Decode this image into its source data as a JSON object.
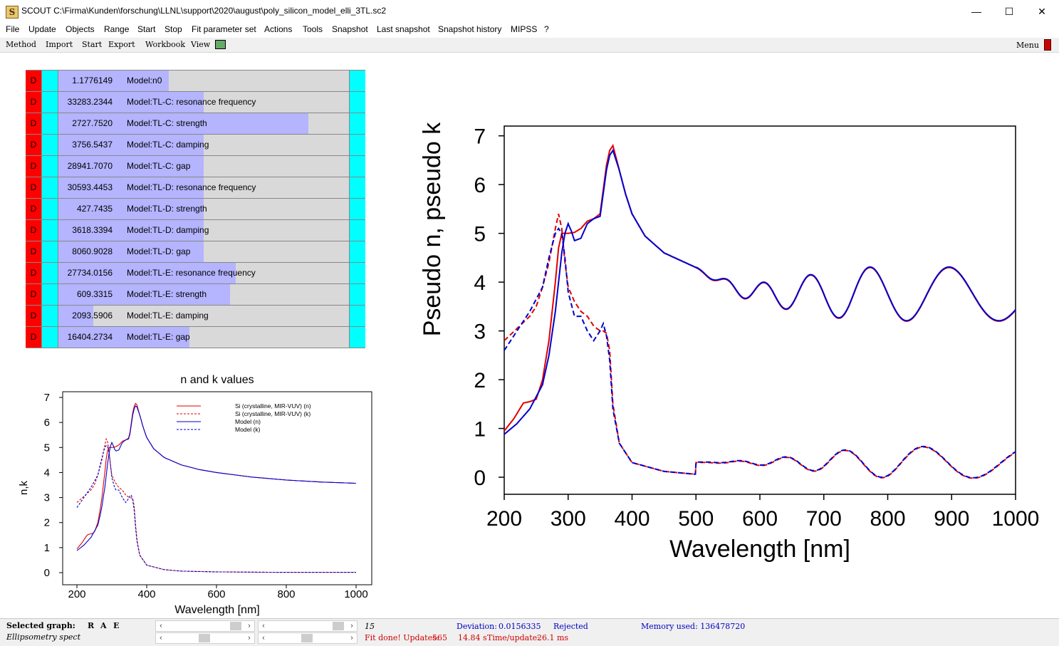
{
  "window": {
    "title": "SCOUT C:\\Firma\\Kunden\\forschung\\LLNL\\support\\2020\\august\\poly_silicon_model_elli_3TL.sc2",
    "icon": "S",
    "minimize": "—",
    "maximize": "☐",
    "close": "✕"
  },
  "menu": [
    "File",
    "Update",
    "Objects",
    "Range",
    "Start",
    "Stop",
    "Fit parameter set",
    "Actions",
    "Tools",
    "Snapshot",
    "Last snapshot",
    "Snapshot history",
    "MIPSS",
    "?"
  ],
  "toolbar": {
    "items": [
      "Method",
      "Import",
      "Start",
      "Export",
      "Workbook",
      "View"
    ],
    "menu_label": "Menu"
  },
  "params": [
    {
      "flag": "D",
      "value": "1.1776149",
      "label": "Model:n0",
      "fill": 0.38
    },
    {
      "flag": "D",
      "value": "33283.2344",
      "label": "Model:TL-C: resonance frequency",
      "fill": 0.5
    },
    {
      "flag": "D",
      "value": "2727.7520",
      "label": "Model:TL-C: strength",
      "fill": 0.86
    },
    {
      "flag": "D",
      "value": "3756.5437",
      "label": "Model:TL-C: damping",
      "fill": 0.5
    },
    {
      "flag": "D",
      "value": "28941.7070",
      "label": "Model:TL-C: gap",
      "fill": 0.5
    },
    {
      "flag": "D",
      "value": "30593.4453",
      "label": "Model:TL-D: resonance frequency",
      "fill": 0.5
    },
    {
      "flag": "D",
      "value": "427.7435",
      "label": "Model:TL-D: strength",
      "fill": 0.5
    },
    {
      "flag": "D",
      "value": "3618.3394",
      "label": "Model:TL-D: damping",
      "fill": 0.5
    },
    {
      "flag": "D",
      "value": "8060.9028",
      "label": "Model:TL-D: gap",
      "fill": 0.5
    },
    {
      "flag": "D",
      "value": "27734.0156",
      "label": "Model:TL-E: resonance frequency",
      "fill": 0.61
    },
    {
      "flag": "D",
      "value": "609.3315",
      "label": "Model:TL-E: strength",
      "fill": 0.59
    },
    {
      "flag": "D",
      "value": "2093.5906",
      "label": "Model:TL-E: damping",
      "fill": 0.12
    },
    {
      "flag": "D",
      "value": "16404.2734",
      "label": "Model:TL-E: gap",
      "fill": 0.45
    }
  ],
  "colors": {
    "si": "#e00000",
    "model": "#0000d0",
    "flag": "#ff0000",
    "cyan": "#00ffff",
    "bar": "#b4b4ff"
  },
  "chart_data": [
    {
      "type": "line",
      "title": "n and k values",
      "xlabel": "Wavelength [nm]",
      "ylabel": "n,k",
      "xlim": [
        200,
        1000
      ],
      "ylim": [
        0,
        7
      ],
      "xticks": [
        200,
        400,
        600,
        800,
        1000
      ],
      "yticks": [
        0,
        1,
        2,
        3,
        4,
        5,
        6,
        7
      ],
      "legend": "top-right",
      "series": [
        {
          "name": "Si (crystalline, MIR-VUV) (n)",
          "color": "#e00000",
          "dash": false,
          "x": [
            200,
            215,
            230,
            240,
            250,
            260,
            270,
            280,
            285,
            290,
            300,
            310,
            320,
            330,
            340,
            350,
            360,
            365,
            370,
            380,
            390,
            400,
            420,
            450,
            500,
            550,
            600,
            700,
            800,
            900,
            1000
          ],
          "y": [
            0.95,
            1.2,
            1.52,
            1.55,
            1.6,
            2.0,
            2.8,
            4.0,
            4.7,
            5.0,
            5.0,
            5.02,
            5.1,
            5.25,
            5.3,
            5.4,
            6.4,
            6.7,
            6.8,
            6.3,
            5.8,
            5.4,
            4.95,
            4.6,
            4.3,
            4.12,
            4.0,
            3.82,
            3.7,
            3.62,
            3.57
          ]
        },
        {
          "name": "Si (crystalline, MIR-VUV) (k)",
          "color": "#e00000",
          "dash": true,
          "x": [
            200,
            220,
            240,
            250,
            260,
            270,
            280,
            285,
            290,
            295,
            300,
            310,
            320,
            330,
            340,
            350,
            355,
            360,
            365,
            370,
            380,
            400,
            450,
            500,
            600,
            800,
            1000
          ],
          "y": [
            2.8,
            3.05,
            3.3,
            3.5,
            3.9,
            4.4,
            5.1,
            5.4,
            5.1,
            4.4,
            3.9,
            3.6,
            3.4,
            3.3,
            3.1,
            3.0,
            3.0,
            2.95,
            2.6,
            1.5,
            0.7,
            0.3,
            0.12,
            0.06,
            0.03,
            0.01,
            0.01
          ]
        },
        {
          "name": "Model (n)",
          "color": "#0000d0",
          "dash": false,
          "x": [
            200,
            220,
            240,
            260,
            270,
            280,
            290,
            295,
            300,
            305,
            310,
            320,
            330,
            340,
            350,
            360,
            365,
            370,
            380,
            390,
            400,
            420,
            450,
            500,
            550,
            600,
            700,
            800,
            900,
            1000
          ],
          "y": [
            0.88,
            1.1,
            1.4,
            1.9,
            2.5,
            3.4,
            4.6,
            5.0,
            5.2,
            5.05,
            4.85,
            4.9,
            5.2,
            5.3,
            5.35,
            6.3,
            6.6,
            6.7,
            6.3,
            5.8,
            5.4,
            4.95,
            4.6,
            4.3,
            4.12,
            4.0,
            3.82,
            3.7,
            3.62,
            3.57
          ]
        },
        {
          "name": "Model (k)",
          "color": "#0000d0",
          "dash": true,
          "x": [
            200,
            220,
            240,
            260,
            270,
            280,
            285,
            290,
            295,
            300,
            310,
            320,
            330,
            340,
            350,
            355,
            360,
            365,
            370,
            380,
            400,
            450,
            500,
            600,
            800,
            1000
          ],
          "y": [
            2.6,
            3.0,
            3.4,
            3.9,
            4.5,
            5.0,
            5.1,
            5.0,
            4.5,
            3.8,
            3.3,
            3.3,
            3.0,
            2.8,
            3.0,
            3.15,
            2.9,
            2.4,
            1.4,
            0.7,
            0.3,
            0.12,
            0.06,
            0.03,
            0.01,
            0.01
          ]
        }
      ]
    },
    {
      "type": "line",
      "xlabel": "Wavelength [nm]",
      "ylabel": "Pseudo n, pseudo k",
      "xlim": [
        200,
        1000
      ],
      "ylim": [
        -0.35,
        7.2
      ],
      "xticks": [
        200,
        300,
        400,
        500,
        600,
        700,
        800,
        900,
        1000
      ],
      "yticks": [
        0,
        1,
        2,
        3,
        4,
        5,
        6,
        7
      ],
      "series": [
        {
          "color": "#e00000",
          "dash": false,
          "role": "n",
          "interference": true
        },
        {
          "color": "#e00000",
          "dash": true,
          "role": "k",
          "interference": true
        },
        {
          "color": "#0000d0",
          "dash": false,
          "role": "n",
          "interference": true
        },
        {
          "color": "#0000d0",
          "dash": true,
          "role": "k",
          "interference": true
        }
      ]
    }
  ],
  "status": {
    "selected_graph_label": "Selected graph:",
    "r": "R",
    "a": "A",
    "e": "E",
    "graph_name": "Ellipsometry spect",
    "iteration": "15",
    "deviation_label": "Deviation:",
    "deviation": "0.0156335",
    "rejected": "Rejected",
    "memory": "Memory used: 136478720",
    "fit_done": "Fit done! Updates:",
    "updates": "565",
    "time": "14.84 s",
    "time_update_label": "Time/update:",
    "time_update": "26.1 ms"
  }
}
